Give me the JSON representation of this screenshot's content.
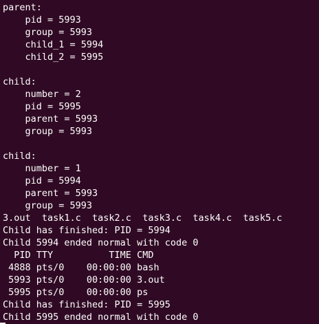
{
  "terminal": {
    "lines": [
      "parent:",
      "    pid = 5993",
      "    group = 5993",
      "    child_1 = 5994",
      "    child_2 = 5995",
      "",
      "child:",
      "    number = 2",
      "    pid = 5995",
      "    parent = 5993",
      "    group = 5993",
      "",
      "child:",
      "    number = 1",
      "    pid = 5994",
      "    parent = 5993",
      "    group = 5993",
      "3.out  task1.c  task2.c  task3.c  task4.c  task5.c",
      "Child has finished: PID = 5994",
      "Child 5994 ended normal with code 0",
      "  PID TTY          TIME CMD",
      " 4888 pts/0    00:00:00 bash",
      " 5993 pts/0    00:00:00 3.out",
      " 5995 pts/0    00:00:00 ps",
      "Child has finished: PID = 5995",
      "Child 5995 ended normal with code 0"
    ]
  },
  "colors": {
    "background": "#300a24",
    "text": "#ffffff"
  }
}
